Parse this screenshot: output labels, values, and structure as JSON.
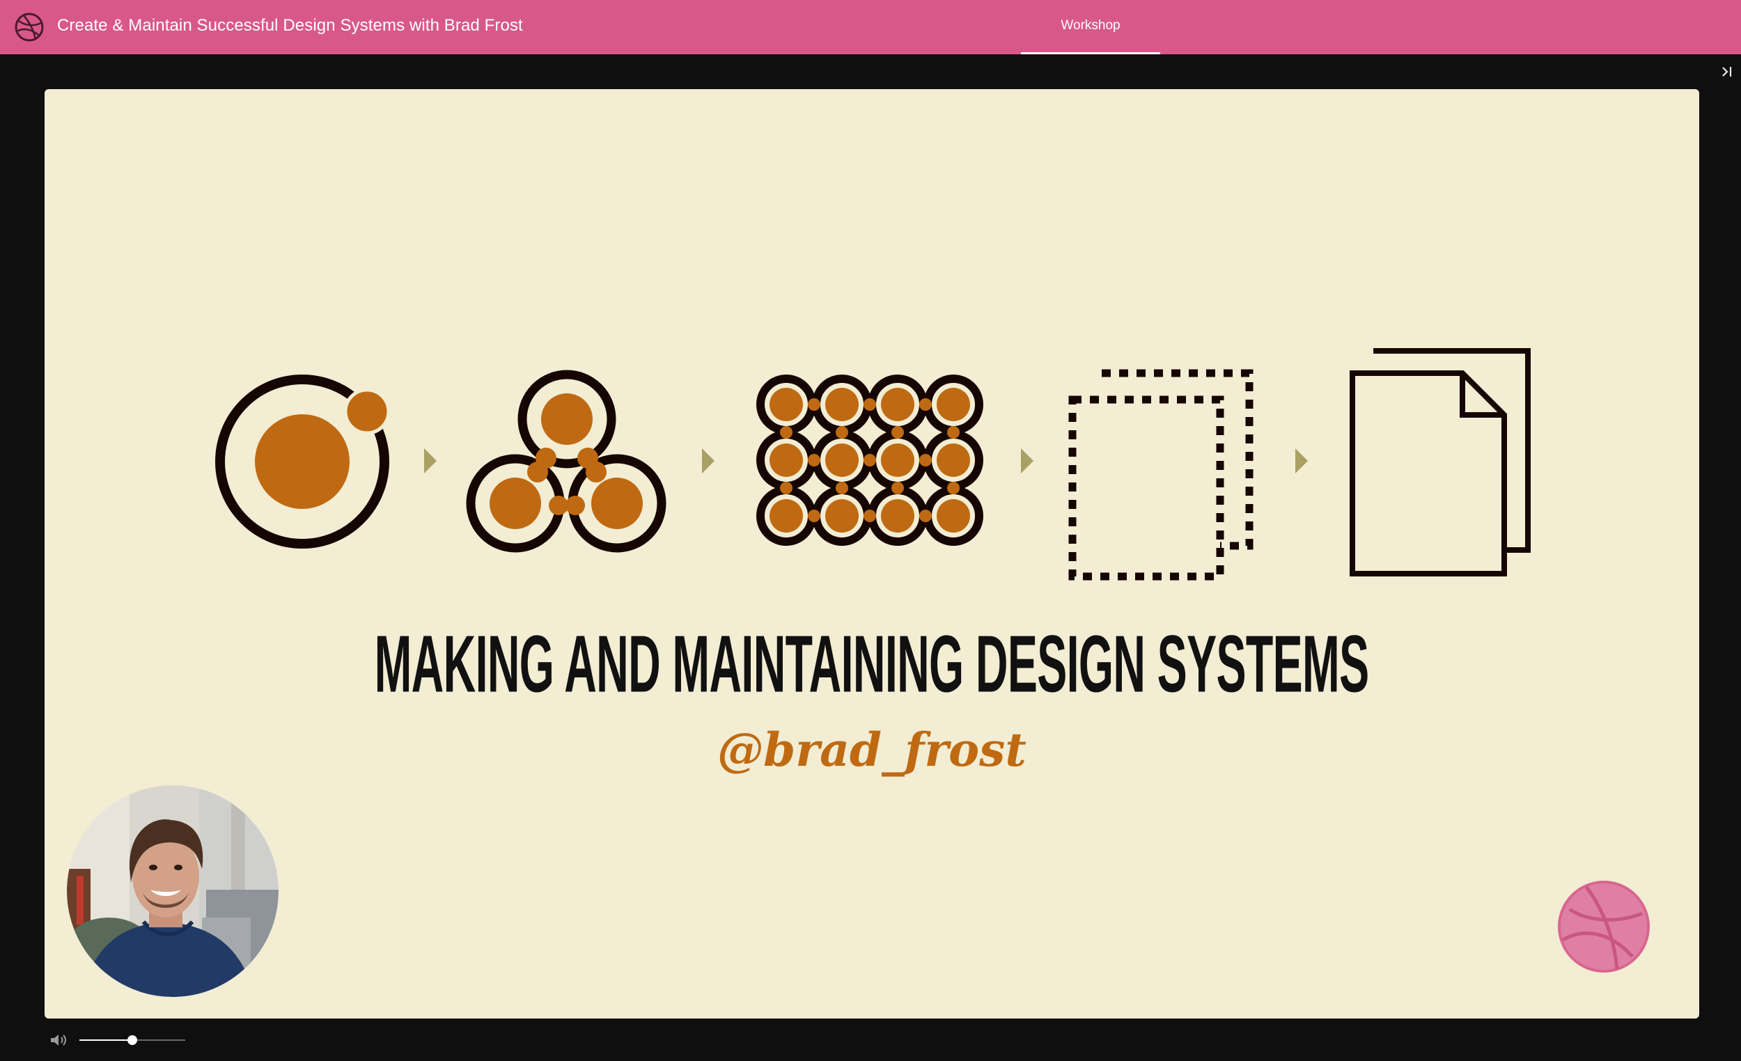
{
  "header": {
    "title": "Create & Maintain Successful Design Systems with Brad Frost",
    "tabs": [
      {
        "label": "Workshop",
        "active": true
      }
    ]
  },
  "slide": {
    "heading": "MAKING AND MAINTAINING DESIGN SYSTEMS",
    "handle": "@brad_frost",
    "stages": [
      "atom-icon",
      "molecule-icon",
      "organism-icon",
      "template-icon",
      "page-icon"
    ]
  },
  "controls": {
    "volume_level": 0.5
  },
  "colors": {
    "brand": "#d9588a",
    "slide_bg": "#f2edd3",
    "accent_orange": "#bf6a12",
    "arrow": "#a9a064",
    "ink": "#160603"
  },
  "icons": {
    "logo": "dribbble-ball-icon",
    "collapse": "collapse-panel-icon",
    "volume": "speaker-icon",
    "watermark": "dribbble-ball-icon"
  }
}
